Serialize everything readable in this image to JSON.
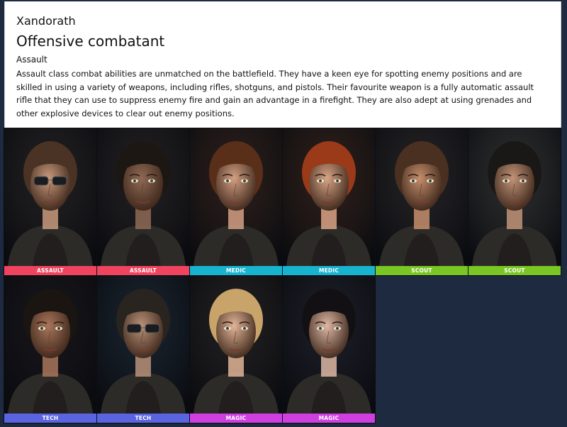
{
  "header": {
    "brand": "Xandorath",
    "title": "Offensive combatant",
    "class_name": "Assault",
    "description": "Assault class combat abilities are unmatched on the battlefield. They have a keen eye for spotting enemy positions and are skilled in using a variety of weapons, including rifles, shotguns, and pistols. Their favourite weapon is a fully automatic assault rifle that they can use to suppress enemy fire and gain an advantage in a firefight. They are also adept at using grenades and other explosive devices to clear out enemy positions."
  },
  "colors": {
    "assault": "#f0435f",
    "medic": "#17b3cf",
    "scout": "#7ac625",
    "tech": "#5a63e0",
    "magic": "#cf3fe0",
    "background": "#1e2a3f"
  },
  "characters": [
    {
      "label": "ASSAULT",
      "role": "assault",
      "hair": "#4a3324",
      "skin": "#c99a7d",
      "bg": "#2a2522",
      "glasses": true
    },
    {
      "label": "ASSAULT",
      "role": "assault",
      "hair": "#1d1714",
      "skin": "#8f6a55",
      "bg": "#2b2420",
      "glasses": false
    },
    {
      "label": "MEDIC",
      "role": "medic",
      "hair": "#5a2f1a",
      "skin": "#d4a083",
      "bg": "#3a2418",
      "glasses": false
    },
    {
      "label": "MEDIC",
      "role": "medic",
      "hair": "#9a3a18",
      "skin": "#d9a586",
      "bg": "#3d2518",
      "glasses": false
    },
    {
      "label": "SCOUT",
      "role": "scout",
      "hair": "#4a3020",
      "skin": "#c58e6c",
      "bg": "#2e2a28",
      "glasses": false
    },
    {
      "label": "SCOUT",
      "role": "scout",
      "hair": "#1a1816",
      "skin": "#c29479",
      "bg": "#3b3a35",
      "glasses": false
    },
    {
      "label": "TECH",
      "role": "tech",
      "hair": "#1b1512",
      "skin": "#a9765b",
      "bg": "#1b1516",
      "glasses": false
    },
    {
      "label": "TECH",
      "role": "tech",
      "hair": "#2a2420",
      "skin": "#b9927a",
      "bg": "#1d2a35",
      "glasses": true
    },
    {
      "label": "MAGIC",
      "role": "magic",
      "hair": "#c8a46a",
      "skin": "#e2b597",
      "bg": "#2a2420",
      "glasses": false
    },
    {
      "label": "MAGIC",
      "role": "magic",
      "hair": "#121012",
      "skin": "#ddb7a5",
      "bg": "#23222a",
      "glasses": false
    }
  ]
}
